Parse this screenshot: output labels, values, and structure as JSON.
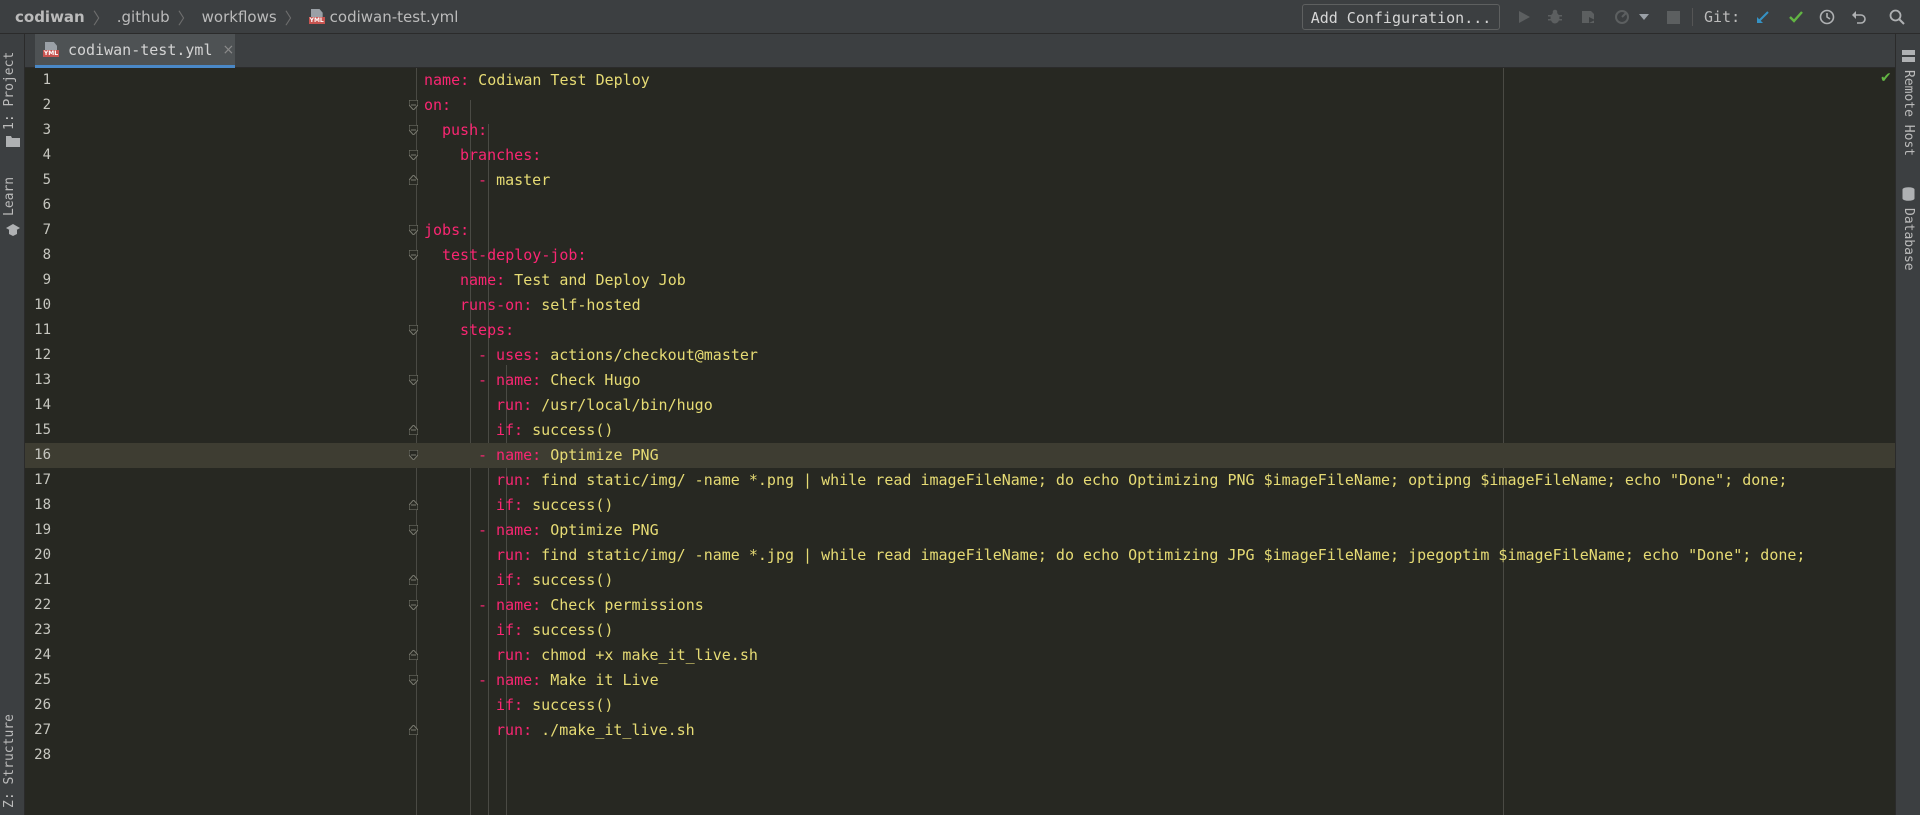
{
  "breadcrumbs": [
    "codiwan",
    ".github",
    "workflows",
    "codiwan-test.yml"
  ],
  "toolbar": {
    "add_configuration": "Add Configuration...",
    "git_label": "Git:"
  },
  "left_strip": {
    "project": "1: Project",
    "learn": "Learn",
    "structure": "Z: Structure"
  },
  "right_strip": {
    "remote_host": "Remote Host",
    "database": "Database"
  },
  "tab": {
    "name": "codiwan-test.yml",
    "close": "×"
  },
  "editor": {
    "current_line": 16,
    "lines": [
      {
        "n": "1",
        "indent": 0,
        "key": "name:",
        "val": " Codiwan Test Deploy"
      },
      {
        "n": "2",
        "indent": 0,
        "key": "on:",
        "val": ""
      },
      {
        "n": "3",
        "indent": 1,
        "key": "push:",
        "val": ""
      },
      {
        "n": "4",
        "indent": 2,
        "key": "branches:",
        "val": ""
      },
      {
        "n": "5",
        "indent": 3,
        "key": "- ",
        "val": "master"
      },
      {
        "n": "6",
        "indent": 0,
        "key": "",
        "val": ""
      },
      {
        "n": "7",
        "indent": 0,
        "key": "jobs:",
        "val": ""
      },
      {
        "n": "8",
        "indent": 1,
        "key": "test-deploy-job:",
        "val": ""
      },
      {
        "n": "9",
        "indent": 2,
        "key": "name:",
        "val": " Test and Deploy Job"
      },
      {
        "n": "10",
        "indent": 2,
        "key": "runs-on:",
        "val": " self-hosted"
      },
      {
        "n": "11",
        "indent": 2,
        "key": "steps:",
        "val": ""
      },
      {
        "n": "12",
        "indent": 3,
        "key": "- uses:",
        "val": " actions/checkout@master"
      },
      {
        "n": "13",
        "indent": 3,
        "key": "- name:",
        "val": " Check Hugo"
      },
      {
        "n": "14",
        "indent": 4,
        "key": "run:",
        "val": " /usr/local/bin/hugo"
      },
      {
        "n": "15",
        "indent": 4,
        "key": "if:",
        "val": " success()"
      },
      {
        "n": "16",
        "indent": 3,
        "key": "- name:",
        "val": " Optimize PNG"
      },
      {
        "n": "17",
        "indent": 4,
        "key": "run:",
        "val": " find static/img/ -name *.png | while read imageFileName; do echo Optimizing PNG $imageFileName; optipng $imageFileName; echo \"Done\"; done;"
      },
      {
        "n": "18",
        "indent": 4,
        "key": "if:",
        "val": " success()"
      },
      {
        "n": "19",
        "indent": 3,
        "key": "- name:",
        "val": " Optimize PNG"
      },
      {
        "n": "20",
        "indent": 4,
        "key": "run:",
        "val": " find static/img/ -name *.jpg | while read imageFileName; do echo Optimizing JPG $imageFileName; jpegoptim $imageFileName; echo \"Done\"; done;"
      },
      {
        "n": "21",
        "indent": 4,
        "key": "if:",
        "val": " success()"
      },
      {
        "n": "22",
        "indent": 3,
        "key": "- name:",
        "val": " Check permissions"
      },
      {
        "n": "23",
        "indent": 4,
        "key": "if:",
        "val": " success()"
      },
      {
        "n": "24",
        "indent": 4,
        "key": "run:",
        "val": " chmod +x make_it_live.sh"
      },
      {
        "n": "25",
        "indent": 3,
        "key": "- name:",
        "val": " Make it Live"
      },
      {
        "n": "26",
        "indent": 4,
        "key": "if:",
        "val": " success()"
      },
      {
        "n": "27",
        "indent": 4,
        "key": "run:",
        "val": " ./make_it_live.sh"
      },
      {
        "n": "28",
        "indent": 0,
        "key": "",
        "val": ""
      }
    ],
    "folds": {
      "2": "open",
      "3": "open",
      "4": "open",
      "5": "close",
      "7": "open",
      "8": "open",
      "11": "open",
      "13": "open",
      "15": "close",
      "16": "open",
      "18": "close",
      "19": "open",
      "21": "close",
      "22": "open",
      "24": "close",
      "25": "open",
      "27": "close"
    }
  },
  "colors": {
    "key": "#f92672",
    "value": "#e6db74",
    "background": "#272822",
    "accent": "#4a88c7",
    "ok": "#62b543"
  }
}
